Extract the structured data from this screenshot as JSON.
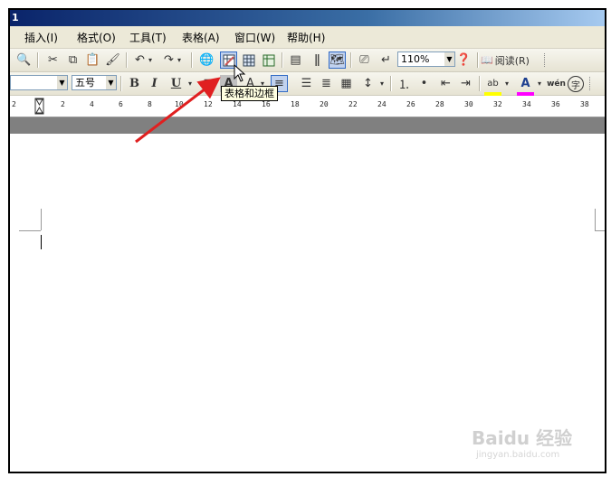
{
  "window": {
    "title": "1"
  },
  "menubar": {
    "items": [
      {
        "label": "插入(I)"
      },
      {
        "label": "格式(O)"
      },
      {
        "label": "工具(T)"
      },
      {
        "label": "表格(A)"
      },
      {
        "label": "窗口(W)"
      },
      {
        "label": "帮助(H)"
      }
    ]
  },
  "toolbar_standard": {
    "zoom_value": "110%",
    "read_label": "阅读(R)"
  },
  "toolbar_formatting": {
    "font_size_value": "五号",
    "bold": "B",
    "italic": "I",
    "underline": "U",
    "char_shade": "A",
    "font_color": "A",
    "phonetic": "wén",
    "enclose_char": "字"
  },
  "tooltip": {
    "text": "表格和边框"
  },
  "ruler": {
    "labels": [
      "2",
      "2",
      "4",
      "6",
      "8",
      "10",
      "12",
      "14",
      "16",
      "18",
      "20",
      "22",
      "24",
      "26",
      "28",
      "30",
      "32",
      "34",
      "36",
      "38"
    ]
  },
  "watermark": {
    "brand": "Baidu 经验",
    "sub": "jingyan.baidu.com"
  },
  "colors": {
    "annotation_arrow": "#e02020",
    "title_bar": "#0a246a",
    "font_color_bar": "#ff0000",
    "highlight_bar": "#ffff00"
  }
}
